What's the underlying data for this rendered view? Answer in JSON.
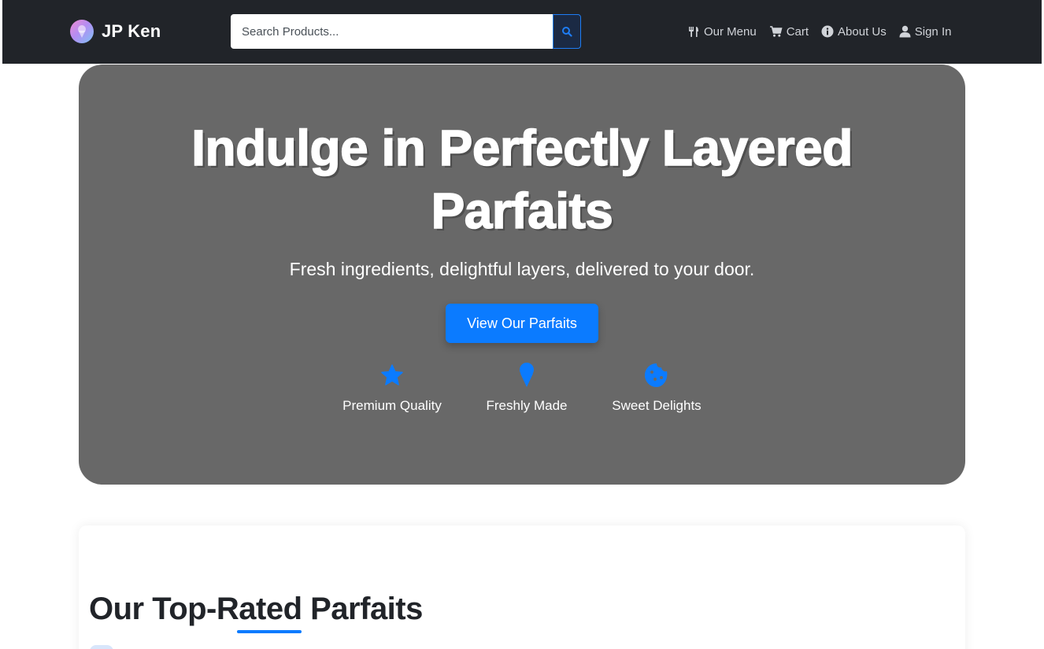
{
  "brand": {
    "name": "JP Ken",
    "logo_icon": "ice-cream-icon"
  },
  "search": {
    "placeholder": "Search Products...",
    "button_icon": "search-icon"
  },
  "nav": {
    "items": [
      {
        "label": "Our Menu",
        "icon": "utensils-icon"
      },
      {
        "label": "Cart",
        "icon": "cart-icon"
      },
      {
        "label": "About Us",
        "icon": "info-icon"
      },
      {
        "label": "Sign In",
        "icon": "user-icon"
      }
    ]
  },
  "hero": {
    "title_line1": "Indulge in Perfectly Layered",
    "title_line2": "Parfaits",
    "subtitle": "Fresh ingredients, delightful layers, delivered to your door.",
    "cta_label": "View Our Parfaits",
    "features": [
      {
        "label": "Premium Quality",
        "icon": "star-icon"
      },
      {
        "label": "Freshly Made",
        "icon": "ice-cream-cone-icon"
      },
      {
        "label": "Sweet Delights",
        "icon": "cookie-icon"
      }
    ]
  },
  "section": {
    "title": "Our Top-Rated Parfaits"
  },
  "colors": {
    "accent": "#0b7bff",
    "navbar": "#212429",
    "hero_bg": "#686868"
  }
}
